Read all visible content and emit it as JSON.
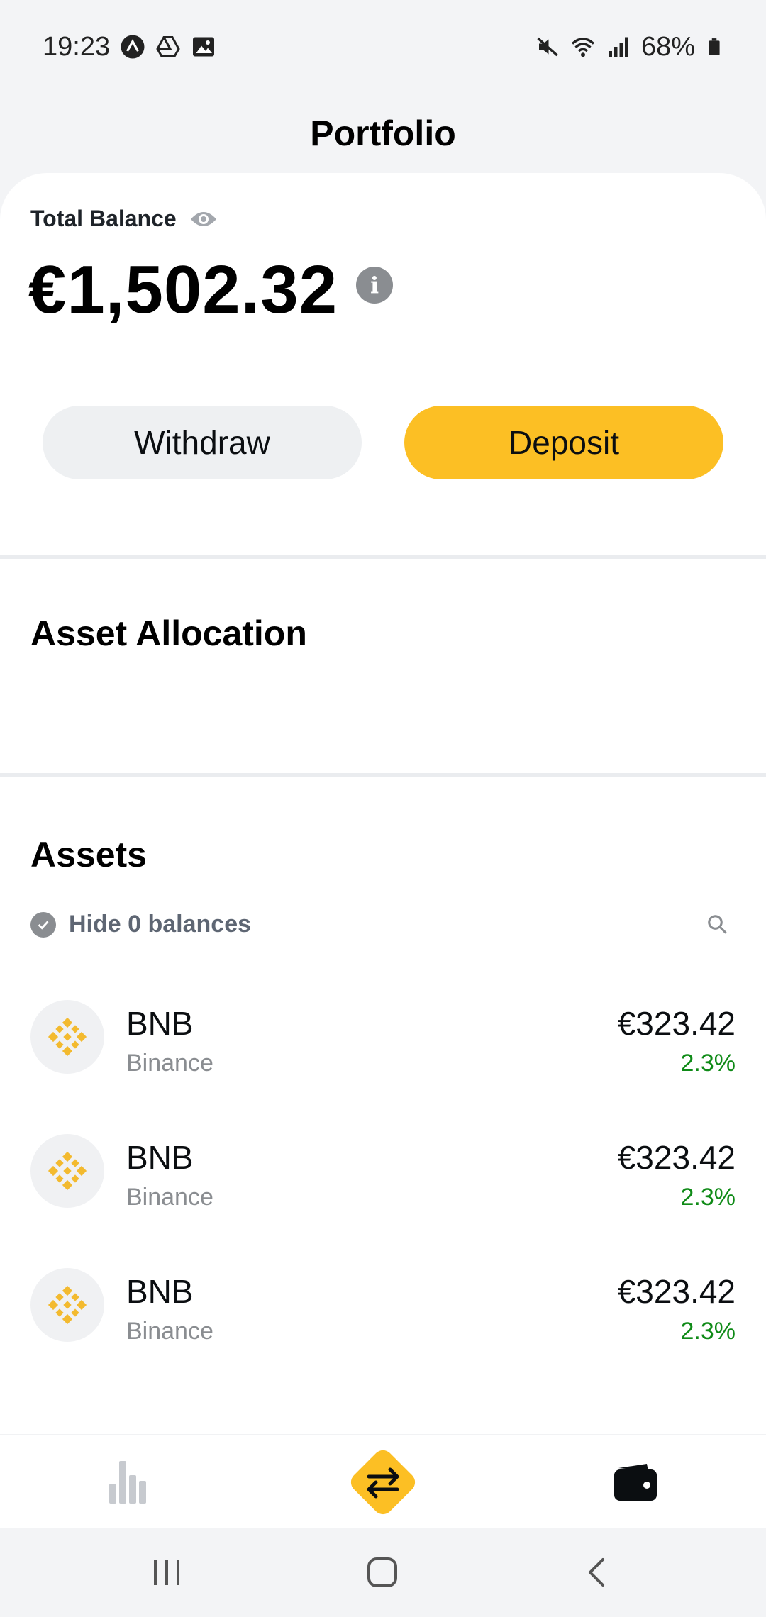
{
  "status_bar": {
    "time": "19:23",
    "battery": "68%",
    "icons_left": [
      "app-a-icon",
      "drive-icon",
      "image-icon"
    ],
    "icons_right": [
      "mute-icon",
      "wifi-icon",
      "signal-icon",
      "battery-icon"
    ]
  },
  "header": {
    "title": "Portfolio"
  },
  "balance": {
    "label": "Total Balance",
    "amount": "€1,502.32",
    "withdraw_label": "Withdraw",
    "deposit_label": "Deposit"
  },
  "allocation": {
    "title": "Asset Allocation"
  },
  "assets": {
    "title": "Assets",
    "hide_zero_label": "Hide 0 balances",
    "items": [
      {
        "symbol": "BNB",
        "name": "Binance",
        "value": "€323.42",
        "change": "2.3%"
      },
      {
        "symbol": "BNB",
        "name": "Binance",
        "value": "€323.42",
        "change": "2.3%"
      },
      {
        "symbol": "BNB",
        "name": "Binance",
        "value": "€323.42",
        "change": "2.3%"
      }
    ]
  },
  "colors": {
    "accent": "#fcbf24",
    "positive": "#0e8a16",
    "muted": "#8a8d91"
  },
  "bottom_nav": {
    "items": [
      "markets-icon",
      "trade-icon",
      "wallet-icon"
    ]
  }
}
